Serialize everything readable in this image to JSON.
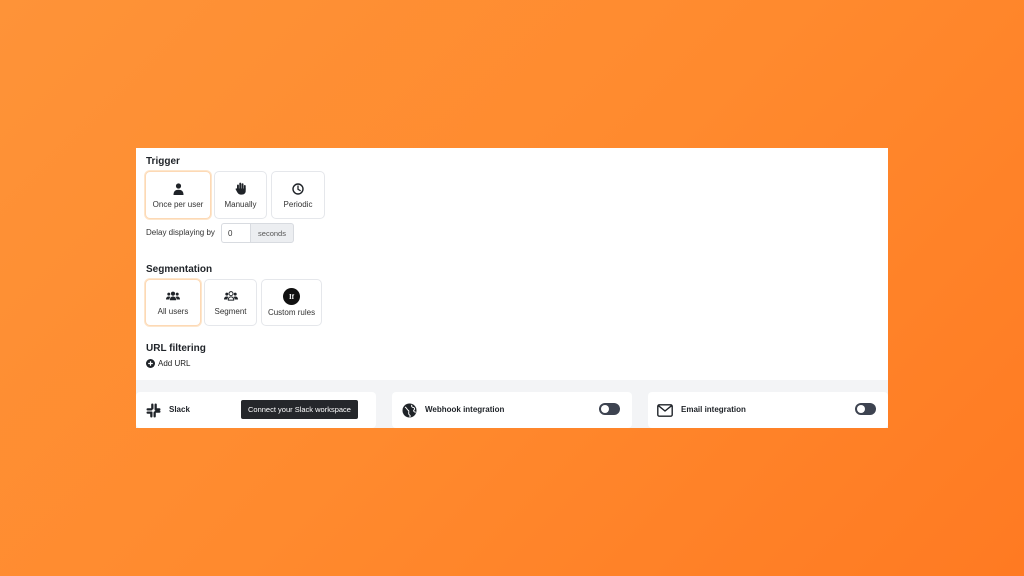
{
  "trigger": {
    "title": "Trigger",
    "options": [
      {
        "label": "Once per user",
        "icon": "user-icon",
        "selected": true
      },
      {
        "label": "Manually",
        "icon": "hand-icon",
        "selected": false
      },
      {
        "label": "Periodic",
        "icon": "clock-icon",
        "selected": false
      }
    ],
    "delay_label": "Delay displaying by",
    "delay_value": "0",
    "delay_unit": "seconds"
  },
  "segmentation": {
    "title": "Segmentation",
    "options": [
      {
        "label": "All users",
        "icon": "users-icon",
        "selected": true
      },
      {
        "label": "Segment",
        "icon": "users-segment-icon",
        "selected": false
      },
      {
        "label": "Custom rules",
        "icon": "if-icon",
        "icon_text": "If",
        "selected": false
      }
    ]
  },
  "url_filtering": {
    "title": "URL filtering",
    "add_label": "Add URL"
  },
  "integrations": [
    {
      "title": "Slack",
      "icon": "slack-icon",
      "action_label": "Connect your Slack workspace"
    },
    {
      "title": "Webhook integration",
      "icon": "globe-icon",
      "enabled": false
    },
    {
      "title": "Email integration",
      "icon": "envelope-icon",
      "enabled": false
    }
  ],
  "colors": {
    "background_start": "#fe9338",
    "background_end": "#ff7a22",
    "selected_border": "#fdd9b5",
    "toggle_off": "#3d4350",
    "tooltip": "#25272b"
  }
}
